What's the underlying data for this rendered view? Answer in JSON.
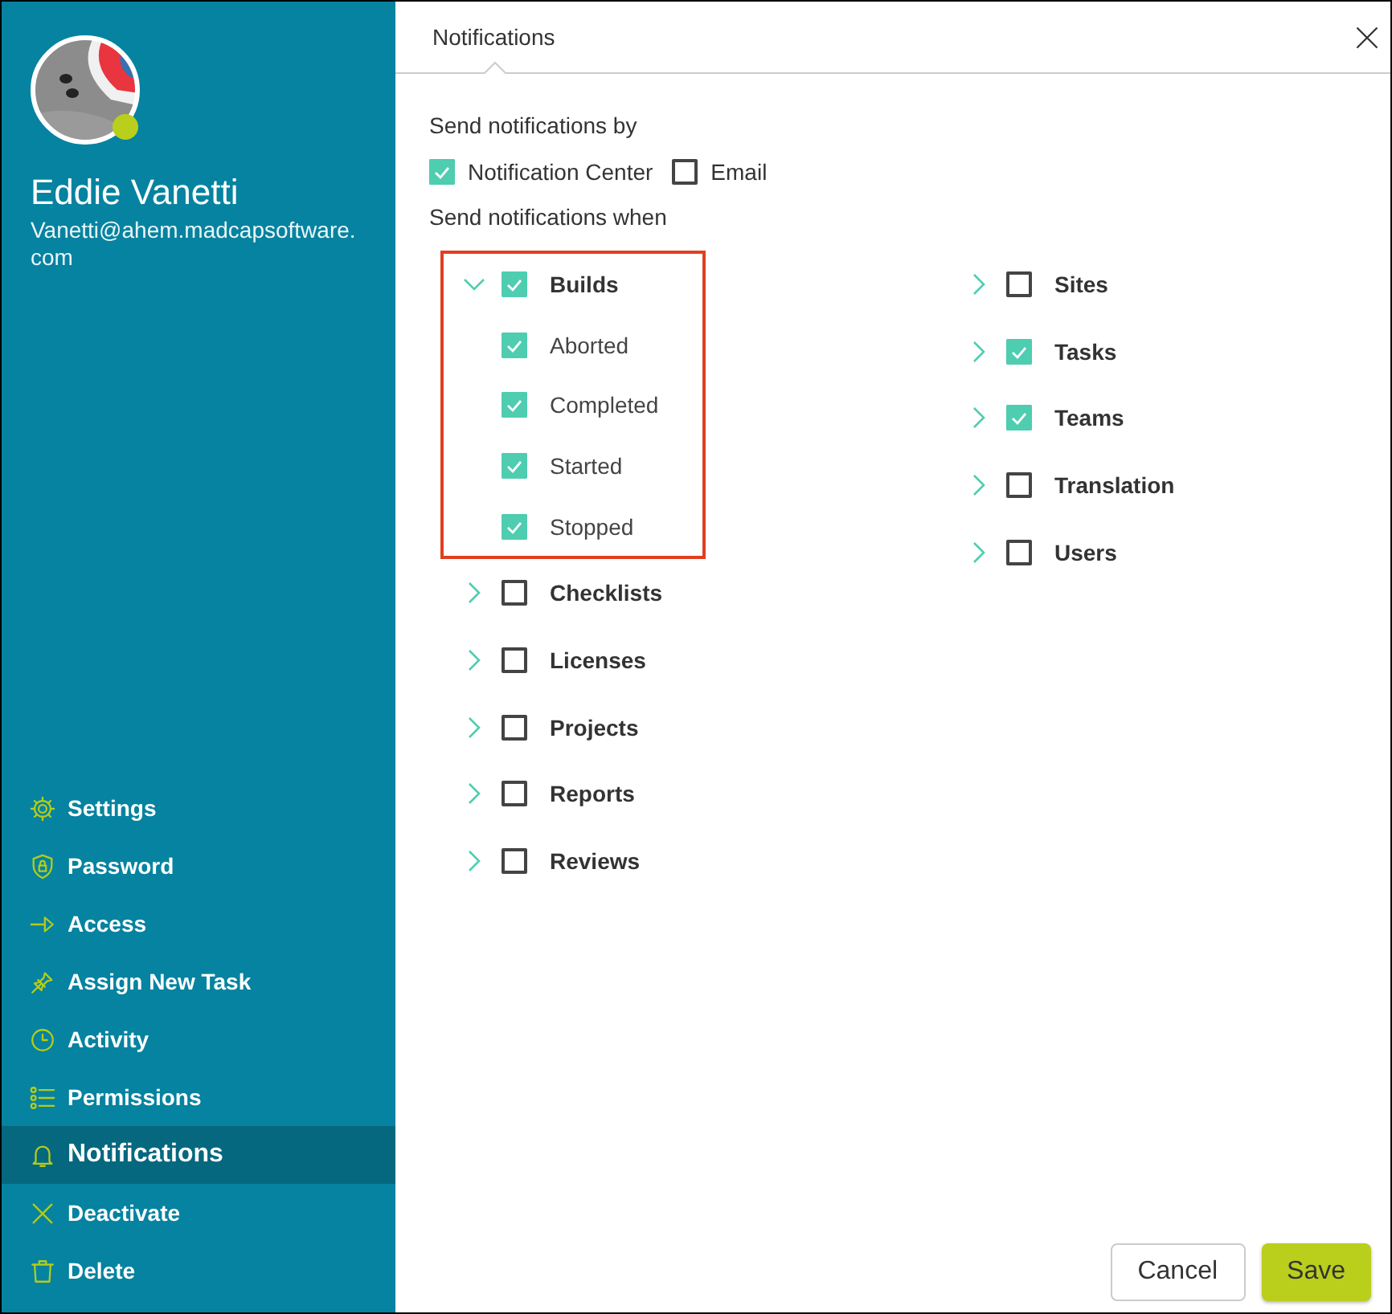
{
  "user": {
    "name": "Eddie Vanetti",
    "email": "Vanetti@ahem.madcapsoftware.com",
    "online": true
  },
  "sidebar": {
    "items": [
      {
        "label": "Settings",
        "selected": false
      },
      {
        "label": "Password",
        "selected": false
      },
      {
        "label": "Access",
        "selected": false
      },
      {
        "label": "Assign New Task",
        "selected": false
      },
      {
        "label": "Activity",
        "selected": false
      },
      {
        "label": "Permissions",
        "selected": false
      },
      {
        "label": "Notifications",
        "selected": true
      },
      {
        "label": "Deactivate",
        "selected": false
      },
      {
        "label": "Delete",
        "selected": false
      }
    ]
  },
  "dialog": {
    "title": "Notifications",
    "send_by_label": "Send notifications by",
    "channels": [
      {
        "label": "Notification Center",
        "checked": true
      },
      {
        "label": "Email",
        "checked": false
      }
    ],
    "send_when_label": "Send notifications when",
    "columns": [
      [
        {
          "label": "Builds",
          "checked": true,
          "expanded": true,
          "highlighted": true,
          "children": [
            {
              "label": "Aborted",
              "checked": true
            },
            {
              "label": "Completed",
              "checked": true
            },
            {
              "label": "Started",
              "checked": true
            },
            {
              "label": "Stopped",
              "checked": true
            }
          ]
        },
        {
          "label": "Checklists",
          "checked": false,
          "expanded": false,
          "highlighted": false
        },
        {
          "label": "Licenses",
          "checked": false,
          "expanded": false,
          "highlighted": false
        },
        {
          "label": "Projects",
          "checked": false,
          "expanded": false,
          "highlighted": false
        },
        {
          "label": "Reports",
          "checked": false,
          "expanded": false,
          "highlighted": false
        },
        {
          "label": "Reviews",
          "checked": false,
          "expanded": false,
          "highlighted": false
        }
      ],
      [
        {
          "label": "Sites",
          "checked": false,
          "expanded": false,
          "highlighted": false
        },
        {
          "label": "Tasks",
          "checked": true,
          "expanded": false,
          "highlighted": false
        },
        {
          "label": "Teams",
          "checked": true,
          "expanded": false,
          "highlighted": false
        },
        {
          "label": "Translation",
          "checked": false,
          "expanded": false,
          "highlighted": false
        },
        {
          "label": "Users",
          "checked": false,
          "expanded": false,
          "highlighted": false
        }
      ]
    ],
    "buttons": [
      {
        "label": "Cancel",
        "kind": "secondary"
      },
      {
        "label": "Save",
        "kind": "primary"
      }
    ]
  }
}
